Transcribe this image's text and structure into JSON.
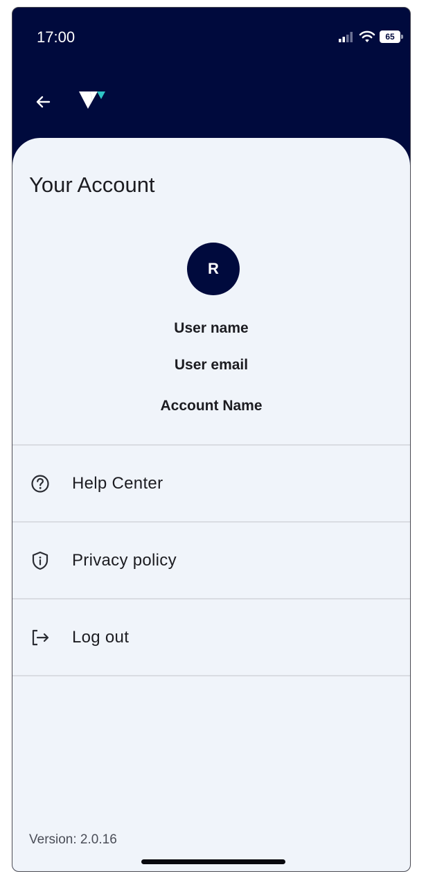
{
  "status_bar": {
    "time": "17:00",
    "battery_level": "65"
  },
  "header": {
    "logo_icon": "v-logo-icon",
    "back_icon": "arrow-left-icon"
  },
  "page": {
    "title": "Your Account"
  },
  "profile": {
    "avatar_initial": "R",
    "user_name": "User name",
    "user_email": "User email",
    "account_name": "Account Name"
  },
  "menu": {
    "items": [
      {
        "label": "Help Center",
        "icon": "help-circle-icon"
      },
      {
        "label": "Privacy policy",
        "icon": "shield-info-icon"
      },
      {
        "label": "Log out",
        "icon": "logout-icon"
      }
    ]
  },
  "footer": {
    "version": "Version: 2.0.16"
  },
  "colors": {
    "header_background": "#000a3d",
    "sheet_background": "#f0f4fa",
    "logo_accent": "#2ec4c4",
    "text_primary": "#1c1c21"
  }
}
